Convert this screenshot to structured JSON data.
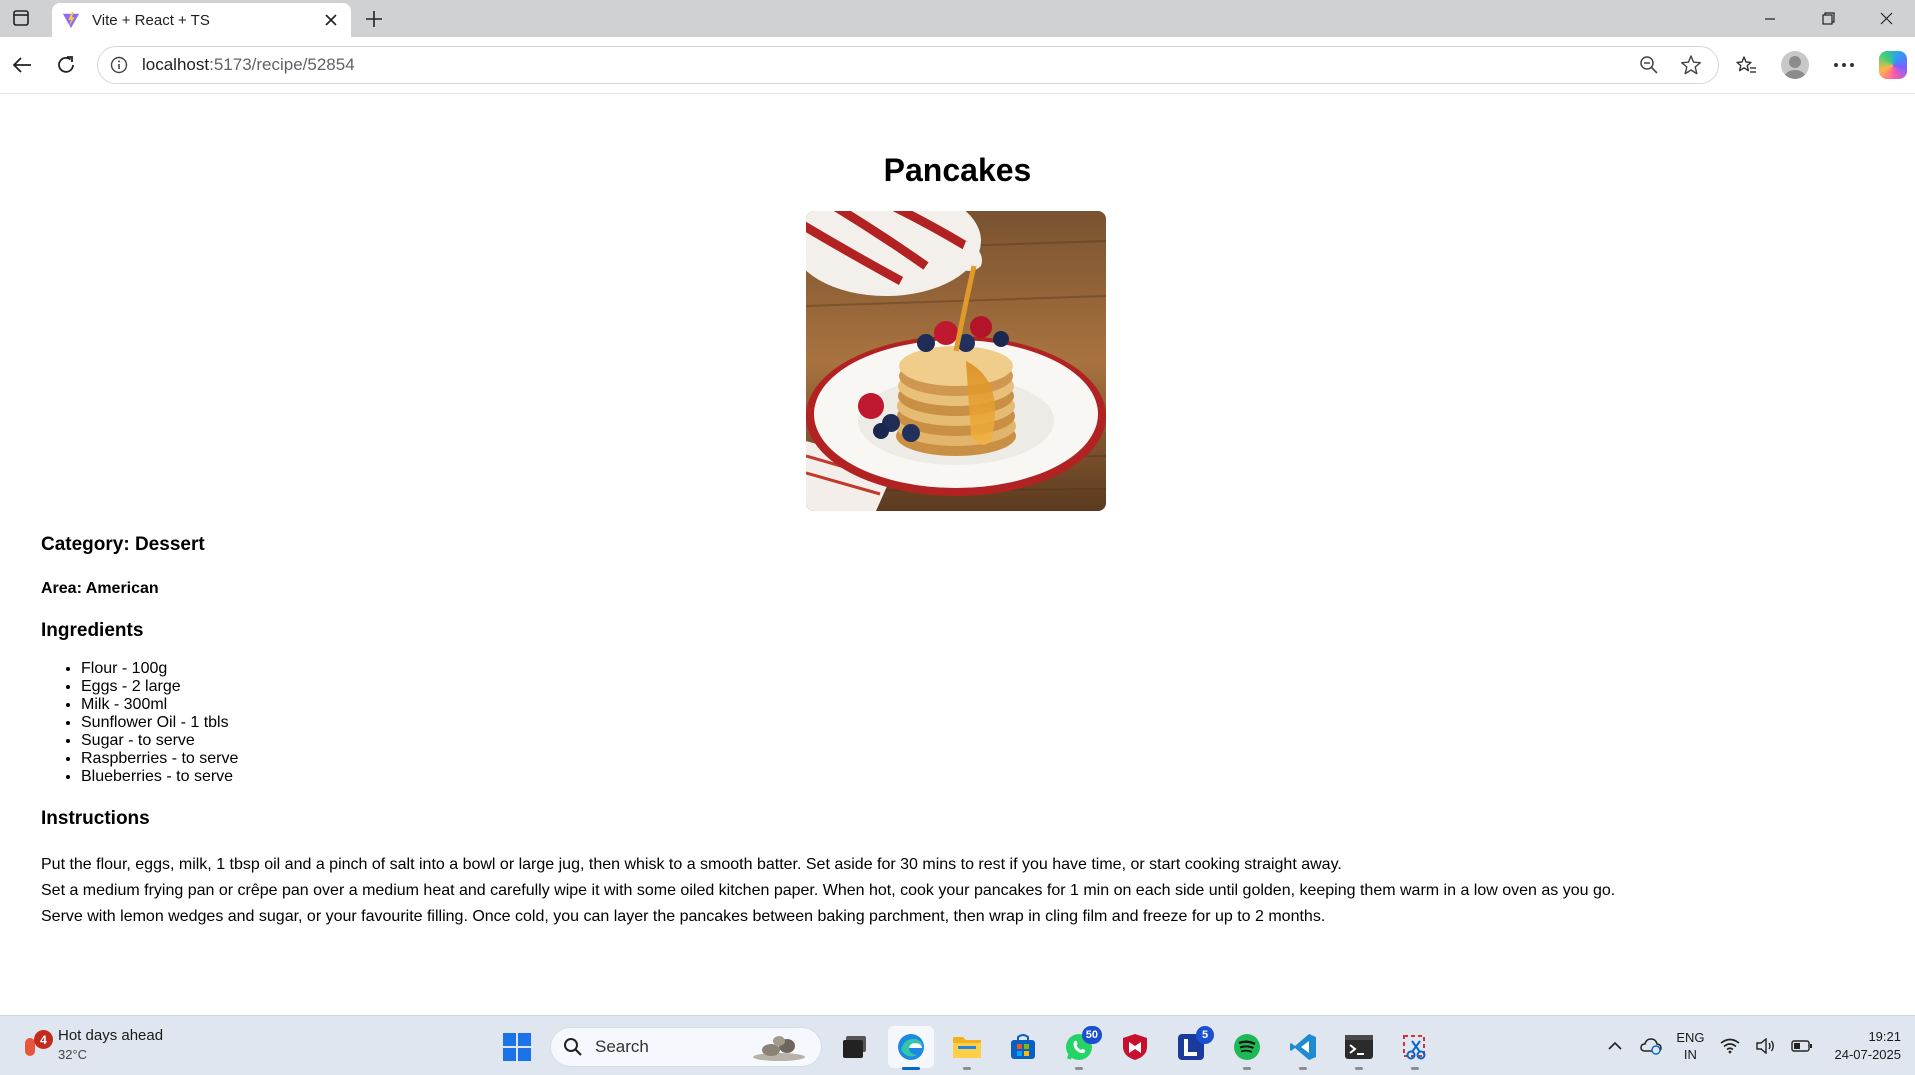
{
  "browser": {
    "tab_title": "Vite + React + TS",
    "url_host": "localhost",
    "url_path": ":5173/recipe/52854"
  },
  "recipe": {
    "title": "Pancakes",
    "category": "Category: Dessert",
    "area": "Area: American",
    "ingredients_heading": "Ingredients",
    "ingredients": [
      "Flour - 100g",
      "Eggs - 2 large",
      "Milk - 300ml",
      "Sunflower Oil - 1 tbls",
      "Sugar - to serve",
      "Raspberries - to serve",
      "Blueberries - to serve"
    ],
    "instructions_heading": "Instructions",
    "instructions": [
      "Put the flour, eggs, milk, 1 tbsp oil and a pinch of salt into a bowl or large jug, then whisk to a smooth batter. Set aside for 30 mins to rest if you have time, or start cooking straight away.",
      "Set a medium frying pan or crêpe pan over a medium heat and carefully wipe it with some oiled kitchen paper. When hot, cook your pancakes for 1 min on each side until golden, keeping them warm in a low oven as you go.",
      "Serve with lemon wedges and sugar, or your favourite filling. Once cold, you can layer the pancakes between baking parchment, then wrap in cling film and freeze for up to 2 months."
    ]
  },
  "taskbar": {
    "weather_title": "Hot days ahead",
    "weather_temp": "32°C",
    "weather_badge": "4",
    "search_label": "Search",
    "whatsapp_badge": "50",
    "lapp_badge": "5",
    "lang_line1": "ENG",
    "lang_line2": "IN",
    "time": "19:21",
    "date": "24-07-2025"
  }
}
